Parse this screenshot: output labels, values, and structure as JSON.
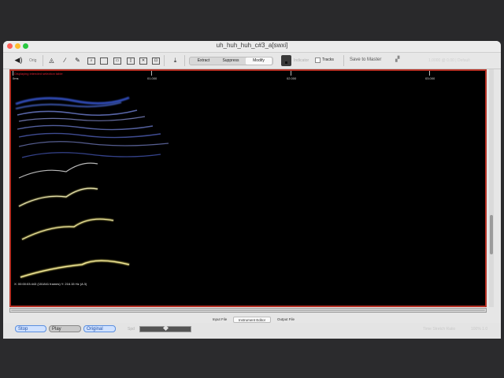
{
  "window": {
    "title": "uh_huh_huh_c#3_a[swxi]"
  },
  "toolbar": {
    "orig_label": "Orig",
    "extract": "Extract",
    "suppress": "Suppress",
    "modify": "Modify",
    "faded_label": "Indicator",
    "tracks": "Tracks",
    "save_to_master": "Save to Master",
    "right_ghost": "1.0000 @ 0.00 | Default"
  },
  "spectrogram": {
    "overlay_text": "Displaying intended selection table",
    "ticks": [
      "0ms",
      "01.000",
      "02.000",
      "03.000"
    ],
    "readout": "X: 00:00:03:443 (151841 frames)   Y: 216.15 Hz (A 3)"
  },
  "tabs": [
    "Input File",
    "Instrument Editor",
    "Output File"
  ],
  "footer": {
    "stop": "Stop",
    "play": "Play",
    "original": "Original",
    "speed": "Spd",
    "ghost1": "Time Stretch Ratio",
    "ghost2": "100%  1.0"
  },
  "colors": {
    "border_red": "#b53024",
    "accent_blue": "#5b8fdf"
  }
}
